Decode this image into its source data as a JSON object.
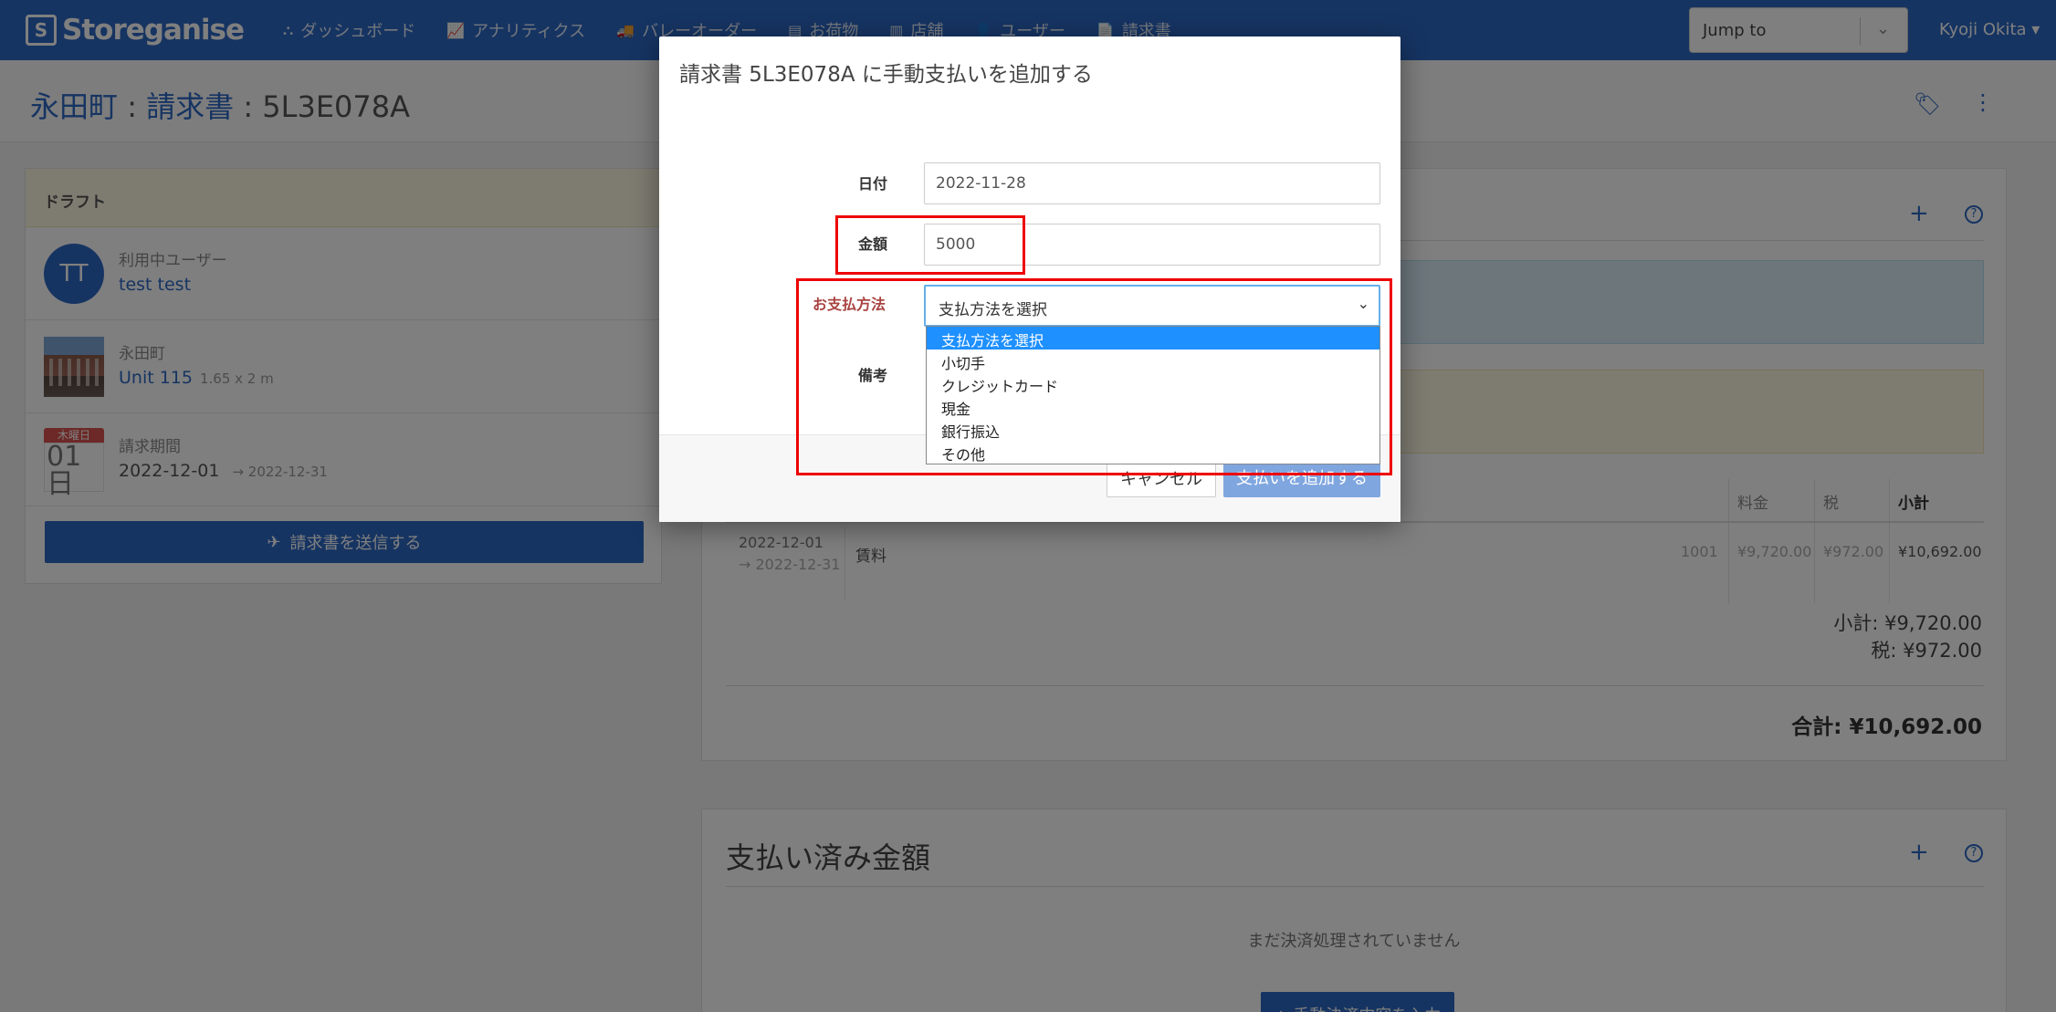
{
  "nav": {
    "brand": "Storeganise",
    "items": [
      {
        "icon": "sitemap-icon",
        "glyph": "⛬",
        "label": "ダッシュボード"
      },
      {
        "icon": "chart-icon",
        "glyph": "📈",
        "label": "アナリティクス"
      },
      {
        "icon": "truck-icon",
        "glyph": "🚚",
        "label": "バレーオーダー"
      },
      {
        "icon": "archive-icon",
        "glyph": "▤",
        "label": "お荷物"
      },
      {
        "icon": "building-icon",
        "glyph": "▥",
        "label": "店舗"
      },
      {
        "icon": "user-icon",
        "glyph": "👤",
        "label": "ユーザー"
      },
      {
        "icon": "invoice-icon",
        "glyph": "📄",
        "label": "請求書"
      }
    ],
    "jump_to": "Jump to",
    "user_name": "Kyoji Okita ▾"
  },
  "page": {
    "site": "永田町",
    "sep1": " : ",
    "section": "請求書",
    "sep2": " : ",
    "invoice_id": "5L3E078A"
  },
  "left_card": {
    "status": "ドラフト",
    "customer_label": "利用中ユーザー",
    "customer_initials": "TT",
    "customer_name": "test test",
    "unit_site": "永田町",
    "unit_name": "Unit 115",
    "unit_size": "1.65 x 2 m",
    "calendar_day_name": "木曜日",
    "calendar_day": "01 日",
    "period_label": "請求期間",
    "period_start": "2022-12-01",
    "period_end": "→ 2022-12-31",
    "send_button": "請求書を送信する"
  },
  "invoice_table": {
    "headers": {
      "price": "料金",
      "tax": "税",
      "subtotal": "小計"
    },
    "row": {
      "start": "2022-12-01",
      "end": "→ 2022-12-31",
      "item": "賃料",
      "code": "1001",
      "price": "¥9,720.00",
      "tax": "¥972.00",
      "subtotal": "¥10,692.00"
    },
    "subtotal_line": "小計: ¥9,720.00",
    "tax_line": "税: ¥972.00",
    "total_line": "合計: ¥10,692.00"
  },
  "payments": {
    "title": "支払い済み金額",
    "empty": "まだ決済処理されていません",
    "add_manual": "+ 手動決済内容を入力"
  },
  "modal": {
    "title": "請求書 5L3E078A に手動支払いを追加する",
    "date_label": "日付",
    "date_value": "2022-11-28",
    "amount_label": "金額",
    "amount_value": "5000",
    "method_label": "お支払方法",
    "method_selected": "支払方法を選択",
    "notes_label": "備考",
    "method_options": [
      "支払方法を選択",
      "小切手",
      "クレジットカード",
      "現金",
      "銀行振込",
      "その他"
    ],
    "cancel": "キャンセル",
    "submit": "支払いを追加する"
  },
  "colors": {
    "brand": "#2d68c4",
    "highlight": "#e00000",
    "option_selected": "#1e90ff"
  }
}
